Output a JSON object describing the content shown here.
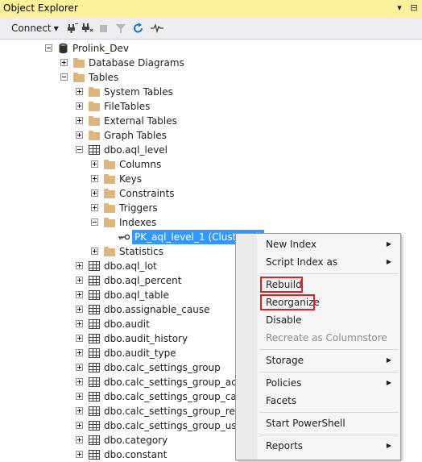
{
  "window": {
    "title": "Object Explorer",
    "dropdown_glyph": "▾",
    "pin_glyph": "⊟"
  },
  "toolbar": {
    "connect_label": "Connect",
    "icons": [
      "connect-icon",
      "disconnect-icon",
      "stop-icon",
      "filter-icon",
      "refresh-icon",
      "activity-monitor-icon"
    ]
  },
  "tree": {
    "server": "Prolink_Dev",
    "database_diagrams": "Database Diagrams",
    "tables": "Tables",
    "system_tables": "System Tables",
    "file_tables": "FileTables",
    "external_tables": "External Tables",
    "graph_tables": "Graph Tables",
    "aql_level": "dbo.aql_level",
    "columns": "Columns",
    "keys": "Keys",
    "constraints": "Constraints",
    "triggers": "Triggers",
    "indexes": "Indexes",
    "selected_index": "PK_aql_level_1 (Clustered)",
    "statistics": "Statistics",
    "table_rows": [
      "dbo.aql_lot",
      "dbo.aql_percent",
      "dbo.aql_table",
      "dbo.assignable_cause",
      "dbo.audit",
      "dbo.audit_history",
      "dbo.audit_type",
      "dbo.calc_settings_group",
      "dbo.calc_settings_group_action",
      "dbo.calc_settings_group_cause",
      "dbo.calc_settings_group_reason",
      "dbo.calc_settings_group_user_r",
      "dbo.category",
      "dbo.constant"
    ]
  },
  "context_menu": {
    "new_index": "New Index",
    "script_index_as": "Script Index as",
    "rebuild": "Rebuild",
    "reorganize": "Reorganize",
    "disable": "Disable",
    "recreate_columnstore": "Recreate as Columnstore",
    "storage": "Storage",
    "policies": "Policies",
    "facets": "Facets",
    "start_powershell": "Start PowerShell",
    "reports": "Reports",
    "submenu_arrow": "▶"
  },
  "colors": {
    "title_bar": "#fff29d",
    "selection": "#3399ff",
    "highlight_box": "#e02020",
    "folder": "#dcb67a"
  }
}
